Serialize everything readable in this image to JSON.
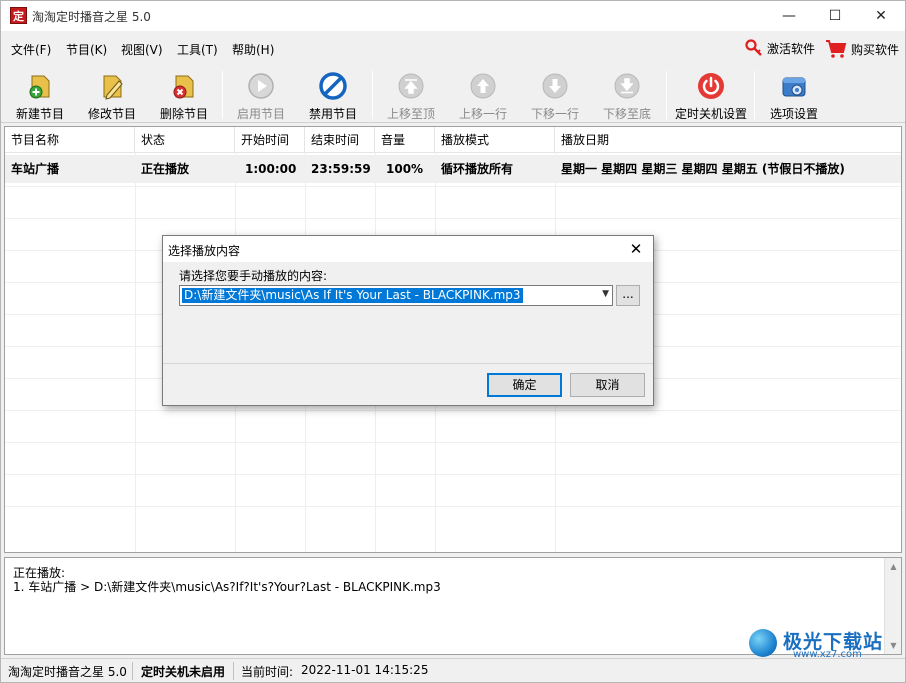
{
  "window": {
    "title": "淘淘定时播音之星 5.0",
    "app_icon_glyph": "定",
    "minimize": "—",
    "maximize": "☐",
    "close": "✕"
  },
  "menu": {
    "items": [
      "文件(F)",
      "节目(K)",
      "视图(V)",
      "工具(T)",
      "帮助(H)"
    ],
    "activate": "激活软件",
    "buy": "购买软件"
  },
  "toolbar": {
    "buttons": [
      {
        "label": "新建节目",
        "icon": "new-program-icon",
        "enabled": true
      },
      {
        "label": "修改节目",
        "icon": "edit-program-icon",
        "enabled": true
      },
      {
        "label": "删除节目",
        "icon": "delete-program-icon",
        "enabled": true
      },
      {
        "label": "启用节目",
        "icon": "enable-program-icon",
        "enabled": false
      },
      {
        "label": "禁用节目",
        "icon": "disable-program-icon",
        "enabled": true
      },
      {
        "label": "上移至顶",
        "icon": "move-top-icon",
        "enabled": false
      },
      {
        "label": "上移一行",
        "icon": "move-up-icon",
        "enabled": false
      },
      {
        "label": "下移一行",
        "icon": "move-down-icon",
        "enabled": false
      },
      {
        "label": "下移至底",
        "icon": "move-bottom-icon",
        "enabled": false
      },
      {
        "label": "定时关机设置",
        "icon": "power-icon",
        "enabled": true
      },
      {
        "label": "选项设置",
        "icon": "options-icon",
        "enabled": true
      }
    ]
  },
  "list": {
    "columns": [
      "节目名称",
      "状态",
      "开始时间",
      "结束时间",
      "音量",
      "播放模式",
      "播放日期"
    ],
    "rows": [
      {
        "name": "车站广播",
        "status": "正在播放",
        "start": "1:00:00",
        "end": "23:59:59",
        "volume": "100%",
        "mode": "循环播放所有",
        "days": "星期一 星期四 星期三 星期四 星期五 (节假日不播放)"
      }
    ]
  },
  "info": {
    "heading": "正在播放:",
    "line1": "1. 车站广播 > D:\\新建文件夹\\music\\As?If?It's?Your?Last - BLACKPINK.mp3"
  },
  "status": {
    "app": "淘淘定时播音之星 5.0",
    "shutdown": "定时关机未启用",
    "time_label": "当前时间:",
    "time_value": "2022-11-01 14:15:25"
  },
  "dialog": {
    "title": "选择播放内容",
    "close": "✕",
    "prompt": "请选择您要手动播放的内容:",
    "selected": "D:\\新建文件夹\\music\\As If It's Your Last - BLACKPINK.mp3",
    "browse": "...",
    "ok": "确定",
    "cancel": "取消"
  },
  "watermark": {
    "brand": "极光下载站",
    "url": "www.xz7.com"
  },
  "colors": {
    "accent": "#0078d7",
    "brand_red": "#c41a1a",
    "disabled_text": "#8a8a8a"
  }
}
